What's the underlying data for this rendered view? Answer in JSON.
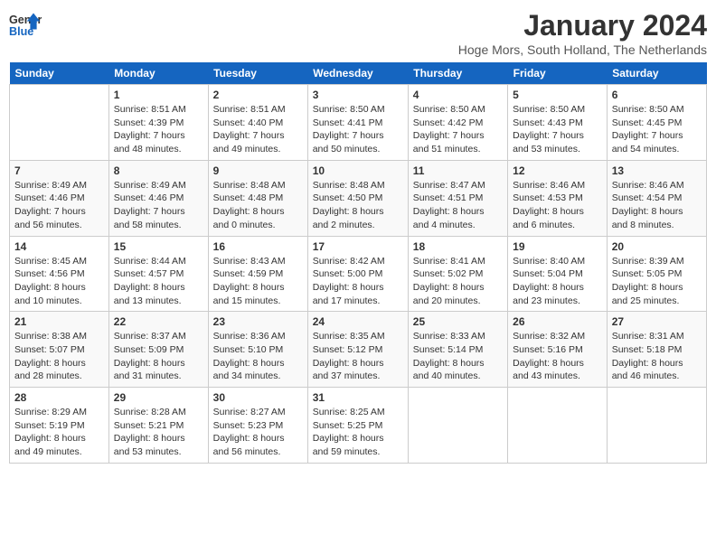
{
  "header": {
    "logo_line1": "General",
    "logo_line2": "Blue",
    "month": "January 2024",
    "location": "Hoge Mors, South Holland, The Netherlands"
  },
  "days_of_week": [
    "Sunday",
    "Monday",
    "Tuesday",
    "Wednesday",
    "Thursday",
    "Friday",
    "Saturday"
  ],
  "weeks": [
    [
      {
        "day": "",
        "info": ""
      },
      {
        "day": "1",
        "info": "Sunrise: 8:51 AM\nSunset: 4:39 PM\nDaylight: 7 hours\nand 48 minutes."
      },
      {
        "day": "2",
        "info": "Sunrise: 8:51 AM\nSunset: 4:40 PM\nDaylight: 7 hours\nand 49 minutes."
      },
      {
        "day": "3",
        "info": "Sunrise: 8:50 AM\nSunset: 4:41 PM\nDaylight: 7 hours\nand 50 minutes."
      },
      {
        "day": "4",
        "info": "Sunrise: 8:50 AM\nSunset: 4:42 PM\nDaylight: 7 hours\nand 51 minutes."
      },
      {
        "day": "5",
        "info": "Sunrise: 8:50 AM\nSunset: 4:43 PM\nDaylight: 7 hours\nand 53 minutes."
      },
      {
        "day": "6",
        "info": "Sunrise: 8:50 AM\nSunset: 4:45 PM\nDaylight: 7 hours\nand 54 minutes."
      }
    ],
    [
      {
        "day": "7",
        "info": ""
      },
      {
        "day": "8",
        "info": "Sunrise: 8:49 AM\nSunset: 4:46 PM\nDaylight: 7 hours\nand 58 minutes."
      },
      {
        "day": "9",
        "info": "Sunrise: 8:48 AM\nSunset: 4:48 PM\nDaylight: 8 hours\nand 0 minutes."
      },
      {
        "day": "10",
        "info": "Sunrise: 8:48 AM\nSunset: 4:50 PM\nDaylight: 8 hours\nand 2 minutes."
      },
      {
        "day": "11",
        "info": "Sunrise: 8:47 AM\nSunset: 4:51 PM\nDaylight: 8 hours\nand 4 minutes."
      },
      {
        "day": "12",
        "info": "Sunrise: 8:46 AM\nSunset: 4:53 PM\nDaylight: 8 hours\nand 6 minutes."
      },
      {
        "day": "13",
        "info": "Sunrise: 8:46 AM\nSunset: 4:54 PM\nDaylight: 8 hours\nand 8 minutes."
      }
    ],
    [
      {
        "day": "14",
        "info": ""
      },
      {
        "day": "15",
        "info": "Sunrise: 8:44 AM\nSunset: 4:57 PM\nDaylight: 8 hours\nand 13 minutes."
      },
      {
        "day": "16",
        "info": "Sunrise: 8:43 AM\nSunset: 4:59 PM\nDaylight: 8 hours\nand 15 minutes."
      },
      {
        "day": "17",
        "info": "Sunrise: 8:42 AM\nSunset: 5:00 PM\nDaylight: 8 hours\nand 17 minutes."
      },
      {
        "day": "18",
        "info": "Sunrise: 8:41 AM\nSunset: 5:02 PM\nDaylight: 8 hours\nand 20 minutes."
      },
      {
        "day": "19",
        "info": "Sunrise: 8:40 AM\nSunset: 5:04 PM\nDaylight: 8 hours\nand 23 minutes."
      },
      {
        "day": "20",
        "info": "Sunrise: 8:39 AM\nSunset: 5:05 PM\nDaylight: 8 hours\nand 25 minutes."
      }
    ],
    [
      {
        "day": "21",
        "info": ""
      },
      {
        "day": "22",
        "info": "Sunrise: 8:37 AM\nSunset: 5:09 PM\nDaylight: 8 hours\nand 31 minutes."
      },
      {
        "day": "23",
        "info": "Sunrise: 8:36 AM\nSunset: 5:10 PM\nDaylight: 8 hours\nand 34 minutes."
      },
      {
        "day": "24",
        "info": "Sunrise: 8:35 AM\nSunset: 5:12 PM\nDaylight: 8 hours\nand 37 minutes."
      },
      {
        "day": "25",
        "info": "Sunrise: 8:33 AM\nSunset: 5:14 PM\nDaylight: 8 hours\nand 40 minutes."
      },
      {
        "day": "26",
        "info": "Sunrise: 8:32 AM\nSunset: 5:16 PM\nDaylight: 8 hours\nand 43 minutes."
      },
      {
        "day": "27",
        "info": "Sunrise: 8:31 AM\nSunset: 5:18 PM\nDaylight: 8 hours\nand 46 minutes."
      }
    ],
    [
      {
        "day": "28",
        "info": ""
      },
      {
        "day": "29",
        "info": "Sunrise: 8:28 AM\nSunset: 5:21 PM\nDaylight: 8 hours\nand 53 minutes."
      },
      {
        "day": "30",
        "info": "Sunrise: 8:27 AM\nSunset: 5:23 PM\nDaylight: 8 hours\nand 56 minutes."
      },
      {
        "day": "31",
        "info": "Sunrise: 8:25 AM\nSunset: 5:25 PM\nDaylight: 8 hours\nand 59 minutes."
      },
      {
        "day": "",
        "info": ""
      },
      {
        "day": "",
        "info": ""
      },
      {
        "day": "",
        "info": ""
      }
    ]
  ],
  "week0_day7_info": "Sunrise: 8:49 AM\nSunset: 4:46 PM\nDaylight: 7 hours\nand 56 minutes.",
  "week1_day0_info": "Sunrise: 8:49 AM\nSunset: 4:46 PM\nDaylight: 7 hours\nand 56 minutes.",
  "week2_day0_info": "Sunrise: 8:45 AM\nSunset: 4:56 PM\nDaylight: 8 hours\nand 10 minutes.",
  "week3_day0_info": "Sunrise: 8:38 AM\nSunset: 5:07 PM\nDaylight: 8 hours\nand 28 minutes.",
  "week4_day0_info": "Sunrise: 8:29 AM\nSunset: 5:19 PM\nDaylight: 8 hours\nand 49 minutes."
}
